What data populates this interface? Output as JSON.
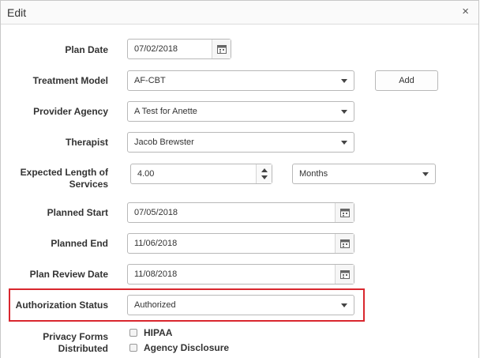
{
  "dialog": {
    "title": "Edit",
    "close_glyph": "×",
    "close_icon": "close-icon"
  },
  "fields": {
    "plan_date": {
      "label": "Plan Date",
      "value": "07/02/2018",
      "icon": "calendar-icon"
    },
    "treatment_model": {
      "label": "Treatment Model",
      "value": "AF-CBT",
      "add_label": "Add"
    },
    "provider_agency": {
      "label": "Provider Agency",
      "value": "A Test for Anette"
    },
    "therapist": {
      "label": "Therapist",
      "value": "Jacob Brewster"
    },
    "expected_length": {
      "label_line1": "Expected Length of",
      "label_line2": "Services",
      "value": "4.00",
      "unit": "Months"
    },
    "planned_start": {
      "label": "Planned Start",
      "value": "07/05/2018"
    },
    "planned_end": {
      "label": "Planned End",
      "value": "11/06/2018"
    },
    "plan_review_date": {
      "label": "Plan Review Date",
      "value": "11/08/2018"
    },
    "authorization_status": {
      "label": "Authorization Status",
      "value": "Authorized"
    },
    "privacy_forms": {
      "label_line1": "Privacy Forms",
      "label_line2": "Distributed",
      "options": [
        {
          "label": "HIPAA",
          "checked": false
        },
        {
          "label": "Agency Disclosure",
          "checked": false
        }
      ]
    }
  },
  "colors": {
    "highlight": "#d9272e",
    "border": "#b8b8b8"
  }
}
